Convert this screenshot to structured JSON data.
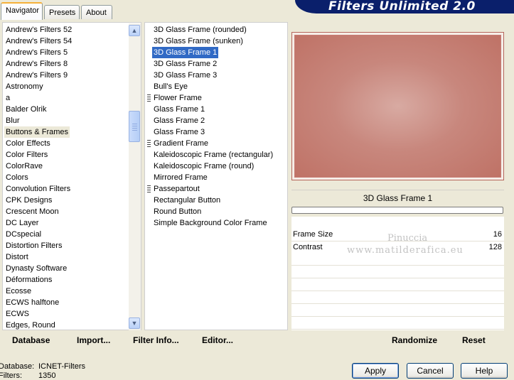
{
  "tabs": [
    "Navigator",
    "Presets",
    "About"
  ],
  "app_title": "Filters Unlimited 2.0",
  "categories": [
    "Andrew's Filters 52",
    "Andrew's Filters 54",
    "Andrew's Filters 5",
    "Andrew's Filters 8",
    "Andrew's Filters 9",
    "Astronomy",
    "a",
    "Balder Olrik",
    "Blur",
    "Buttons & Frames",
    "Color Effects",
    "Color Filters",
    "ColorRave",
    "Colors",
    "Convolution Filters",
    "CPK Designs",
    "Crescent Moon",
    "DC Layer",
    "DCspecial",
    "Distortion Filters",
    "Distort",
    "Dynasty Software",
    "Déformations",
    "Ecosse",
    "ECWS halftone",
    "ECWS",
    "Edges, Round"
  ],
  "selected_category": "Buttons & Frames",
  "filters": [
    "3D Glass Frame (rounded)",
    "3D Glass Frame (sunken)",
    "3D Glass Frame 1",
    "3D Glass Frame 2",
    "3D Glass Frame 3",
    "Bull's Eye",
    "Flower Frame",
    "Glass Frame 1",
    "Glass Frame 2",
    "Glass Frame 3",
    "Gradient Frame",
    "Kaleidoscopic Frame (rectangular)",
    "Kaleidoscopic Frame (round)",
    "Mirrored Frame",
    "Passepartout",
    "Rectangular Button",
    "Round Button",
    "Simple Background Color Frame"
  ],
  "filters_with_marker": [
    "Flower Frame",
    "Gradient Frame",
    "Passepartout"
  ],
  "selected_filter": "3D Glass Frame 1",
  "preview": {
    "title": "3D Glass Frame 1",
    "progress": 0
  },
  "params": [
    {
      "label": "Frame Size",
      "value": "16"
    },
    {
      "label": "Contrast",
      "value": "128"
    }
  ],
  "watermark": {
    "line1": "Pinuccia",
    "line2": "www.matilderafica.eu"
  },
  "left_buttons": {
    "database": "Database",
    "import": "Import...",
    "filter_info": "Filter Info...",
    "editor": "Editor..."
  },
  "right_buttons": {
    "randomize": "Randomize",
    "reset": "Reset"
  },
  "status": {
    "database_label": "Database:",
    "database_value": "ICNET-Filters",
    "filters_label": "Filters:",
    "filters_value": "1350"
  },
  "dialog_buttons": {
    "apply": "Apply",
    "cancel": "Cancel",
    "help": "Help"
  },
  "colors": {
    "selection": "#316ac5",
    "banner": "#0a1f6b",
    "preview_frame": "#bf7266"
  }
}
